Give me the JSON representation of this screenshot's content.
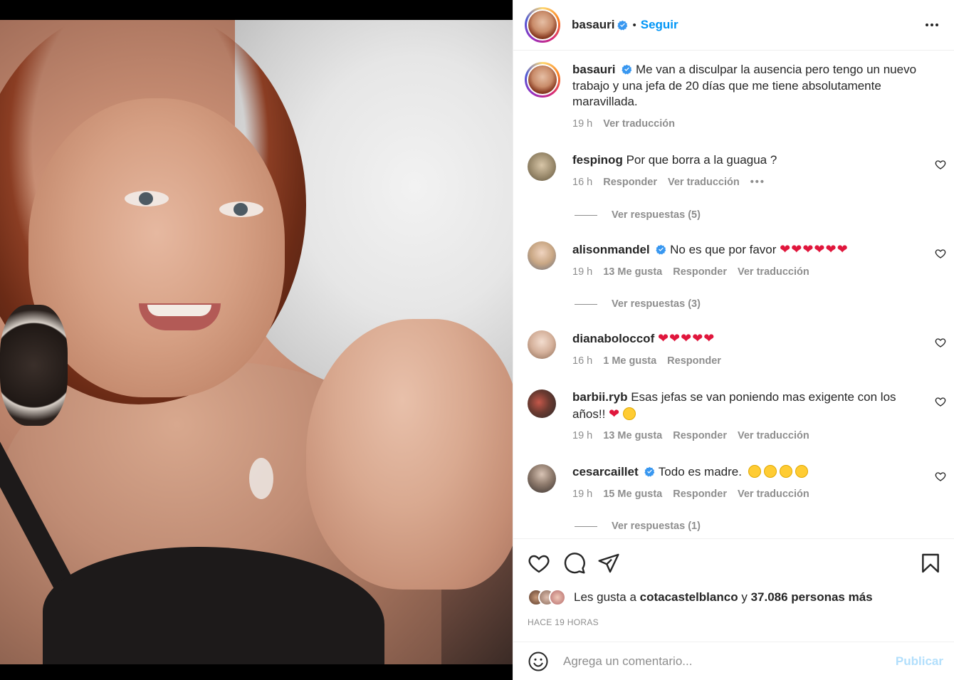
{
  "post": {
    "username": "basauri",
    "separator": "•",
    "follow_label": "Seguir",
    "more_icon": "more-horizontal-icon"
  },
  "caption": {
    "username": "basauri",
    "text": "Me van a disculpar la ausencia pero tengo un nuevo trabajo y una jefa de 20 días que me tiene absolutamente maravillada.",
    "time": "19 h",
    "translate": "Ver traducción"
  },
  "comments": [
    {
      "username": "fespinog",
      "text": "Por que borra a la guagua ?",
      "time": "16 h",
      "likes": "",
      "reply": "Responder",
      "translate": "Ver traducción",
      "more": "•••",
      "replies": "Ver respuestas (5)"
    },
    {
      "username": "alisonmandel",
      "text": "No es que por favor",
      "hearts": "❤❤❤❤❤❤",
      "time": "19 h",
      "likes": "13 Me gusta",
      "reply": "Responder",
      "translate": "Ver traducción",
      "replies": "Ver respuestas (3)"
    },
    {
      "username": "dianaboloccof",
      "hearts": "❤❤❤❤❤",
      "time": "16 h",
      "likes": "1 Me gusta",
      "reply": "Responder"
    },
    {
      "username": "barbii.ryb",
      "text": "Esas jefas se van poniendo mas exigente con los años!!",
      "hearts": "❤",
      "time": "19 h",
      "likes": "13 Me gusta",
      "reply": "Responder",
      "translate": "Ver traducción"
    },
    {
      "username": "cesarcaillet",
      "text": "Todo es madre.",
      "time": "19 h",
      "likes": "15 Me gusta",
      "reply": "Responder",
      "translate": "Ver traducción",
      "replies": "Ver respuestas (1)"
    }
  ],
  "footer": {
    "likes_prefix": "Les gusta a",
    "likes_user": "cotacastelblanco",
    "likes_and": "y",
    "likes_count": "37.086 personas más",
    "timestamp": "HACE 19 HORAS"
  },
  "add_comment": {
    "placeholder": "Agrega un comentario...",
    "publish": "Publicar"
  },
  "colors": {
    "accent": "#0095f6",
    "heart": "#e0163c",
    "muted": "#8e8e8e",
    "publish_disabled": "#b2dffc"
  }
}
